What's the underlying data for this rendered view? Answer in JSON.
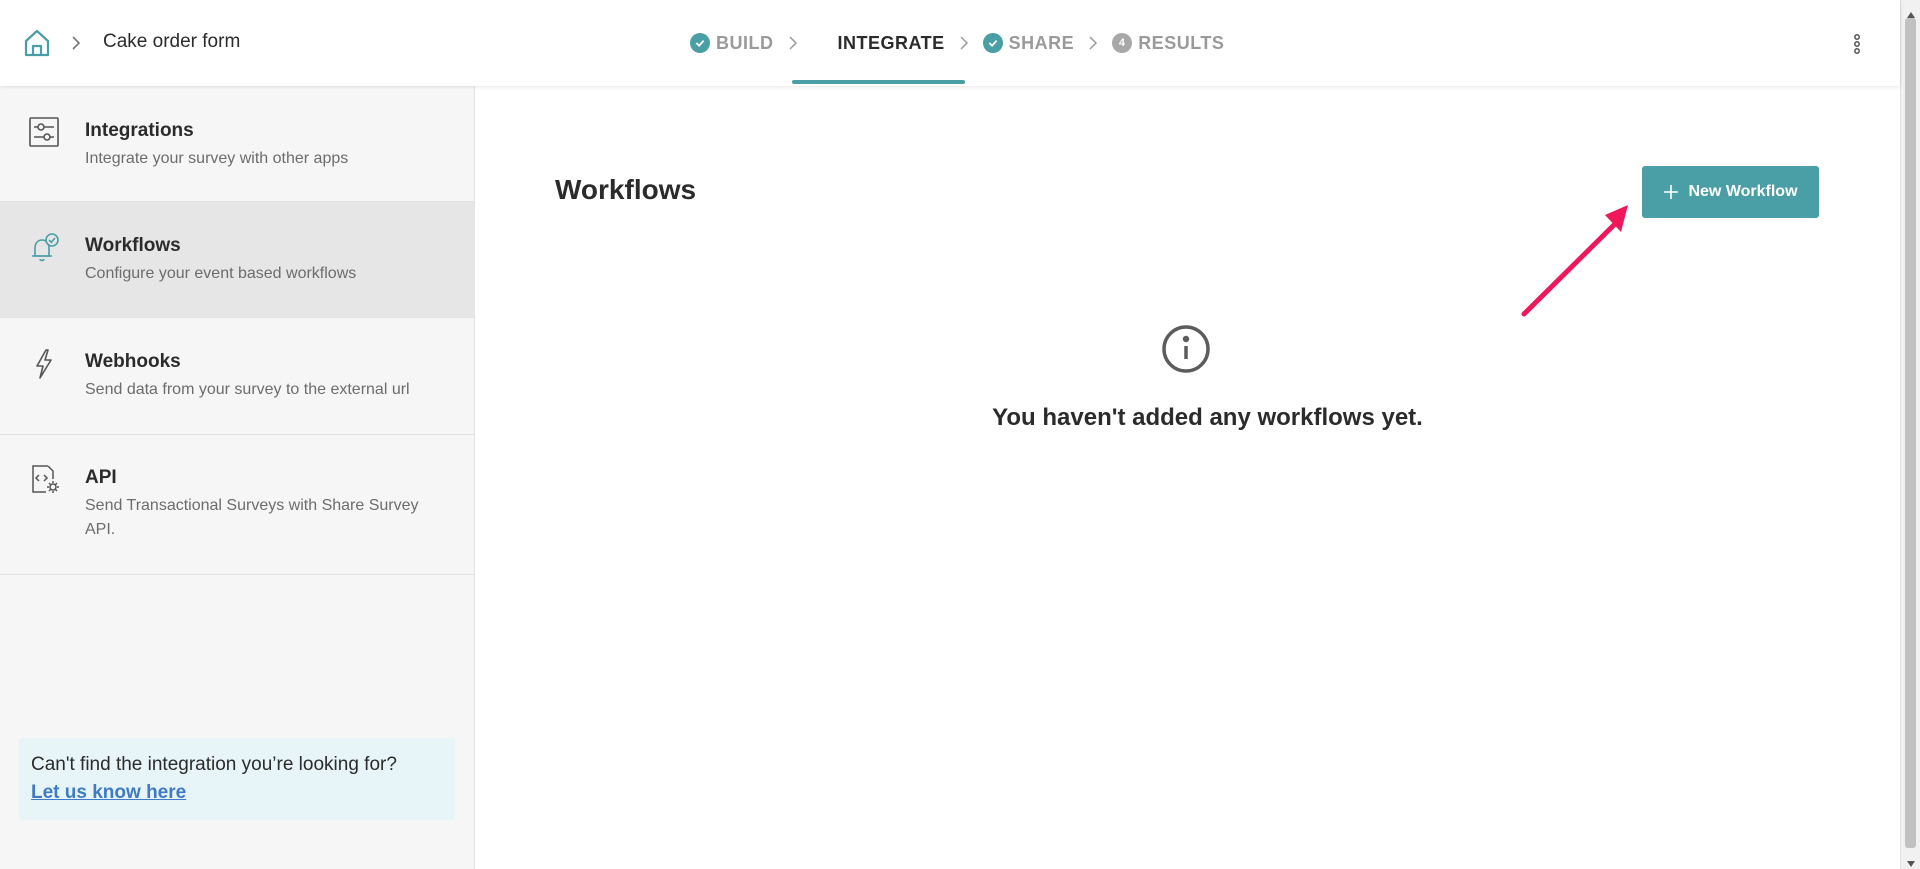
{
  "header": {
    "form_title": "Cake order form",
    "steps": [
      {
        "label": "BUILD",
        "state": "done"
      },
      {
        "label": "INTEGRATE",
        "state": "active"
      },
      {
        "label": "SHARE",
        "state": "done"
      },
      {
        "label": "RESULTS",
        "state": "todo",
        "number": "4"
      }
    ]
  },
  "sidebar": {
    "items": [
      {
        "title": "Integrations",
        "description": "Integrate your survey with other apps",
        "icon": "sliders-icon"
      },
      {
        "title": "Workflows",
        "description": "Configure your event based workflows",
        "icon": "bell-check-icon"
      },
      {
        "title": "Webhooks",
        "description": "Send data from your survey to the external url",
        "icon": "lightning-icon"
      },
      {
        "title": "API",
        "description": "Send Transactional Surveys with Share Survey API.",
        "icon": "code-gear-icon"
      }
    ],
    "help": {
      "question": "Can't find the integration you’re looking for?",
      "link": "Let us know here"
    }
  },
  "main": {
    "title": "Workflows",
    "new_button": "New Workflow",
    "empty_message": "You haven't added any workflows yet."
  },
  "colors": {
    "accent": "#4a9ea6",
    "annotation_arrow": "#f0185a",
    "link": "#3f7ac9",
    "help_bg": "#e7f5f8"
  }
}
